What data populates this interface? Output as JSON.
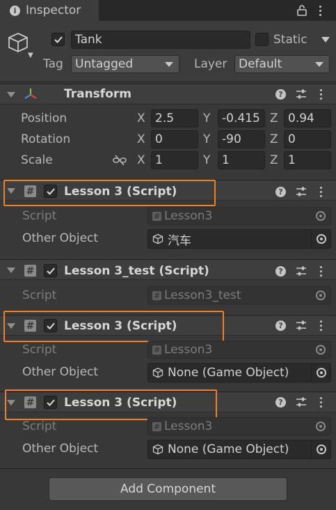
{
  "tab": {
    "label": "Inspector",
    "icon": "info-icon"
  },
  "header": {
    "active": true,
    "name": "Tank",
    "static_label": "Static",
    "tag_label": "Tag",
    "tag_value": "Untagged",
    "layer_label": "Layer",
    "layer_value": "Default"
  },
  "transform": {
    "title": "Transform",
    "rows": [
      {
        "label": "Position",
        "x": "2.5",
        "y": "-0.415",
        "z": "0.94"
      },
      {
        "label": "Rotation",
        "x": "0",
        "y": "-90",
        "z": "0"
      },
      {
        "label": "Scale",
        "x": "1",
        "y": "1",
        "z": "1"
      }
    ],
    "axis": {
      "x": "X",
      "y": "Y",
      "z": "Z"
    }
  },
  "components": [
    {
      "title": "Lesson 3 (Script)",
      "script_label": "Script",
      "script_value": "Lesson3",
      "other_label": "Other Object",
      "other_value": "汽车"
    },
    {
      "title": "Lesson 3_test (Script)",
      "script_label": "Script",
      "script_value": "Lesson3_test"
    },
    {
      "title": "Lesson 3 (Script)",
      "script_label": "Script",
      "script_value": "Lesson3",
      "other_label": "Other Object",
      "other_value": "None (Game Object)"
    },
    {
      "title": "Lesson 3 (Script)",
      "script_label": "Script",
      "script_value": "Lesson3",
      "other_label": "Other Object",
      "other_value": "None (Game Object)"
    }
  ],
  "add_component_label": "Add Component",
  "colors": {
    "highlight": "#f0811e",
    "background": "#383838"
  }
}
